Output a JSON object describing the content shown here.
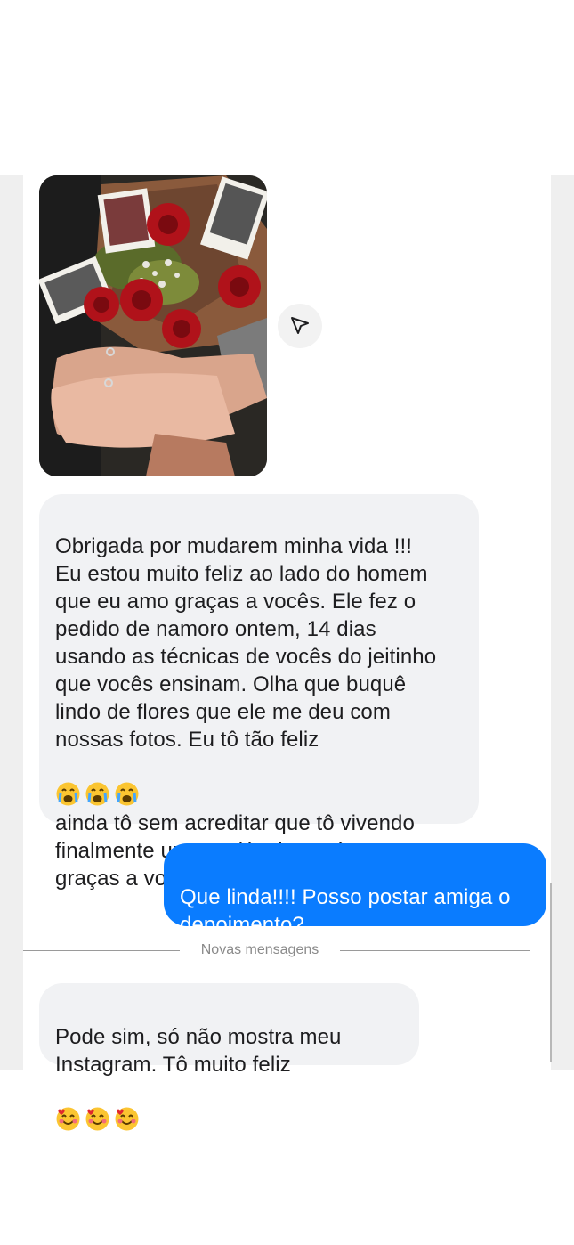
{
  "conversation": {
    "messages": [
      {
        "sender": "received",
        "text": "Obrigada por mudarem minha vida !!!\nEu estou muito feliz ao lado do homem\nque eu amo graças a vocês. Ele fez o\npedido de namoro ontem, 14 dias\nusando as técnicas de vocês do jeitinho\nque vocês ensinam. Olha que buquê\nlindo de flores que ele me deu com\nnossas fotos. Eu tô tão feliz",
        "emojis": [
          "loudly-crying-face",
          "loudly-crying-face",
          "loudly-crying-face"
        ],
        "text_after": "ainda tô sem acreditar que tô vivendo\nfinalmente um saudável e recíproco\ngraças a vocês! Gratidão"
      },
      {
        "sender": "sent",
        "text": "Que linda!!!! Posso postar amiga o\ndepoimento?"
      },
      {
        "sender": "received",
        "text": "Pode sim, só não mostra meu\nInstagram. Tô muito feliz",
        "emojis": [
          "smiling-face-with-hearts",
          "smiling-face-with-hearts",
          "smiling-face-with-hearts"
        ]
      }
    ],
    "divider_label": "Novas mensagens"
  },
  "colors": {
    "sent_bubble": "#0a7cff",
    "received_bubble": "#f1f2f4"
  },
  "icons": {
    "share": "paper-plane-icon"
  }
}
